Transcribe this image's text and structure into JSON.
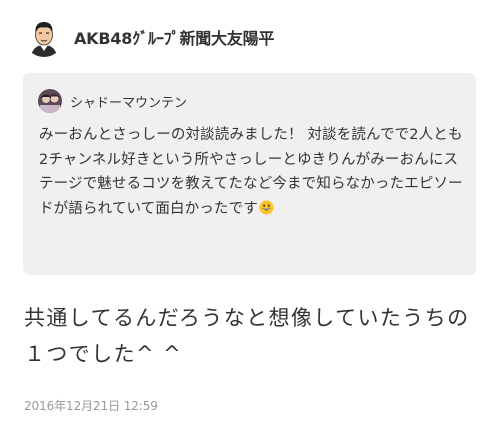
{
  "post": {
    "author": "AKB48ｸﾞﾙｰﾌﾟ新聞大友陽平",
    "avatar_icon": "author-face-avatar",
    "quote": {
      "author": "シャドーマウンテン",
      "avatar_icon": "user-photo-avatar",
      "body": "みーおんとさっしーの対談読みました！ 対談を読んでで2人とも2チャンネル好きという所やさっしーとゆきりんがみーおんにステージで魅せるコツを教えてたなど今まで知らなかったエピソードが語られていて面白かったです",
      "emoji_icon": "grinning-face-emoji"
    },
    "body": "共通してるんだろうなと想像していたうちの１つでした^ ^",
    "timestamp": "2016年12月21日 12:59"
  },
  "colors": {
    "background": "#ffffff",
    "card_background": "#f0f0f0",
    "text": "#333333",
    "muted_text": "#999999"
  }
}
